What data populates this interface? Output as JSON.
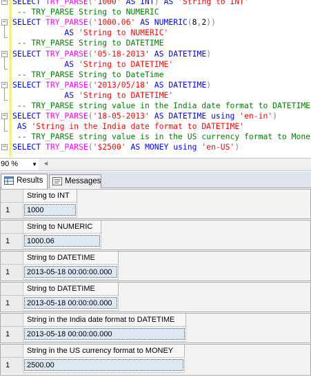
{
  "editor": {
    "lines": [
      [
        {
          "t": "SELECT ",
          "c": "kw"
        },
        {
          "t": "TRY_PARSE",
          "c": "fn"
        },
        {
          "t": "(",
          "c": "op"
        },
        {
          "t": "'1000'",
          "c": "str"
        },
        {
          "t": " AS ",
          "c": "kw"
        },
        {
          "t": "INT",
          "c": "kw"
        },
        {
          "t": ")",
          "c": "op"
        },
        {
          "t": " AS ",
          "c": "kw"
        },
        {
          "t": "'String to INT'",
          "c": "str"
        }
      ],
      [
        {
          "t": " -- TRY_PARSE String to NUMERIC",
          "c": "cm"
        }
      ],
      [
        {
          "t": "SELECT ",
          "c": "kw"
        },
        {
          "t": "TRY_PARSE",
          "c": "fn"
        },
        {
          "t": "(",
          "c": "op"
        },
        {
          "t": "'1000.06'",
          "c": "str"
        },
        {
          "t": " AS ",
          "c": "kw"
        },
        {
          "t": "NUMERIC",
          "c": "kw"
        },
        {
          "t": "(",
          "c": "op"
        },
        {
          "t": "8",
          "c": "num"
        },
        {
          "t": ",",
          "c": "op"
        },
        {
          "t": "2",
          "c": "num"
        },
        {
          "t": "))",
          "c": "op"
        }
      ],
      [
        {
          "t": "           AS ",
          "c": "kw"
        },
        {
          "t": "'String to NUMERIC'",
          "c": "str"
        }
      ],
      [
        {
          "t": " -- TRY_PARSE String to DATETIME",
          "c": "cm"
        }
      ],
      [
        {
          "t": "SELECT ",
          "c": "kw"
        },
        {
          "t": "TRY_PARSE",
          "c": "fn"
        },
        {
          "t": "(",
          "c": "op"
        },
        {
          "t": "'05-18-2013'",
          "c": "str"
        },
        {
          "t": " AS ",
          "c": "kw"
        },
        {
          "t": "DATETIME",
          "c": "kw"
        },
        {
          "t": ")",
          "c": "op"
        }
      ],
      [
        {
          "t": "           AS ",
          "c": "kw"
        },
        {
          "t": "'String to DATETIME'",
          "c": "str"
        }
      ],
      [
        {
          "t": " -- TRY_PARSE String to DateTime",
          "c": "cm"
        }
      ],
      [
        {
          "t": "SELECT ",
          "c": "kw"
        },
        {
          "t": "TRY_PARSE",
          "c": "fn"
        },
        {
          "t": "(",
          "c": "op"
        },
        {
          "t": "'2013/05/18'",
          "c": "str"
        },
        {
          "t": " AS ",
          "c": "kw"
        },
        {
          "t": "DATETIME",
          "c": "kw"
        },
        {
          "t": ")",
          "c": "op"
        }
      ],
      [
        {
          "t": "           AS ",
          "c": "kw"
        },
        {
          "t": "'String to DATETIME'",
          "c": "str"
        }
      ],
      [
        {
          "t": " -- TRY_PARSE string value in the India date format to DATETIME",
          "c": "cm"
        }
      ],
      [
        {
          "t": "SELECT ",
          "c": "kw"
        },
        {
          "t": "TRY_PARSE",
          "c": "fn"
        },
        {
          "t": "(",
          "c": "op"
        },
        {
          "t": "'18-05-2013'",
          "c": "str"
        },
        {
          "t": " AS ",
          "c": "kw"
        },
        {
          "t": "DATETIME",
          "c": "kw"
        },
        {
          "t": " using ",
          "c": "kw"
        },
        {
          "t": "'en-in'",
          "c": "str"
        },
        {
          "t": ")",
          "c": "op"
        }
      ],
      [
        {
          "t": " AS ",
          "c": "kw"
        },
        {
          "t": "'String in the India date format to DATETIME'",
          "c": "str"
        }
      ],
      [
        {
          "t": " -- TRY_PARSE string value is in the US currency format to Money",
          "c": "cm"
        }
      ],
      [
        {
          "t": "SELECT ",
          "c": "kw"
        },
        {
          "t": "TRY_PARSE",
          "c": "fn"
        },
        {
          "t": "(",
          "c": "op"
        },
        {
          "t": "'$2500'",
          "c": "str"
        },
        {
          "t": " AS ",
          "c": "kw"
        },
        {
          "t": "MONEY",
          "c": "kw"
        },
        {
          "t": " using ",
          "c": "kw"
        },
        {
          "t": "'en-US'",
          "c": "str"
        },
        {
          "t": ")",
          "c": "op"
        }
      ]
    ]
  },
  "zoom": {
    "value": "90 %"
  },
  "tabs": [
    {
      "label": "Results",
      "active": true
    },
    {
      "label": "Messages",
      "active": false
    }
  ],
  "results": [
    {
      "header": "String to INT",
      "row": "1",
      "value": "1000"
    },
    {
      "header": "String to NUMERIC",
      "row": "1",
      "value": "1000.06"
    },
    {
      "header": "String to DATETIME",
      "row": "1",
      "value": "2013-05-18 00:00:00.000"
    },
    {
      "header": "String to DATETIME",
      "row": "1",
      "value": "2013-05-18 00:00:00.000"
    },
    {
      "header": "String in the India date format to DATETIME",
      "row": "1",
      "value": "2013-05-18 00:00:00.000"
    },
    {
      "header": "String in the US currency format to MONEY",
      "row": "1",
      "value": "2500.00"
    }
  ],
  "colors": {
    "keyword": "#0000ff",
    "function": "#ff00ff",
    "string": "#ff0000",
    "comment": "#008000"
  }
}
